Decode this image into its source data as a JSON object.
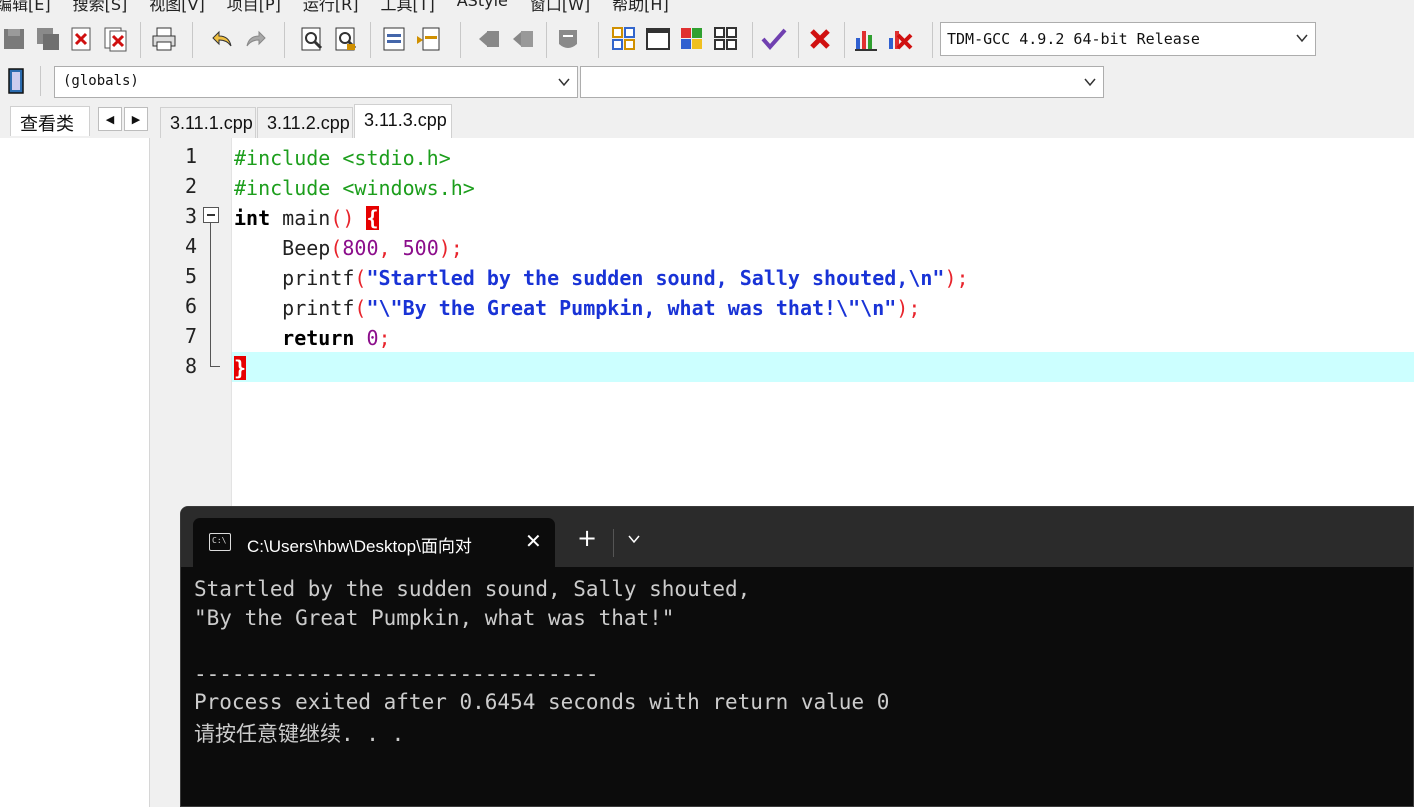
{
  "menubar": [
    "编辑[E]",
    "搜索[S]",
    "视图[V]",
    "项目[P]",
    "运行[R]",
    "工具[T]",
    "AStyle",
    "窗口[W]",
    "帮助[H]"
  ],
  "toolbar": {
    "compiler": "TDM-GCC 4.9.2 64-bit Release"
  },
  "toolbar2": {
    "scope": "(globals)",
    "member": ""
  },
  "leftpane": {
    "tab_label": "查看类"
  },
  "file_tabs": [
    "3.11.1.cpp",
    "3.11.2.cpp",
    "3.11.3.cpp"
  ],
  "active_tab": "3.11.3.cpp",
  "editor": {
    "line_numbers": [
      "1",
      "2",
      "3",
      "4",
      "5",
      "6",
      "7",
      "8"
    ],
    "line1": "#include <stdio.h>",
    "line2": "#include <windows.h>",
    "line3_kw": "int",
    "line3_fn": " main",
    "line3_sym": "() ",
    "line3_brace": "{",
    "line4_indent": "    ",
    "line4_fn": "Beep",
    "line4_open": "(",
    "line4_n1": "800",
    "line4_comma": ", ",
    "line4_n2": "500",
    "line4_close": ");",
    "line5_fn": "printf",
    "line5_open": "(",
    "line5_str": "\"Startled by the sudden sound, Sally shouted,\\n\"",
    "line5_close": ");",
    "line6_fn": "printf",
    "line6_open": "(",
    "line6_str": "\"\\\"By the Great Pumpkin, what was that!\\\"\\n\"",
    "line6_close": ");",
    "line7_kw": "return",
    "line7_space": " ",
    "line7_num": "0",
    "line7_semi": ";",
    "line8_brace": "}"
  },
  "console": {
    "tab_title": "C:\\Users\\hbw\\Desktop\\面向对",
    "close_glyph": "✕",
    "plus_glyph": "+",
    "dropdown_glyph": "∨",
    "output": [
      "Startled by the sudden sound, Sally shouted,",
      "\"By the Great Pumpkin, what was that!\"",
      "",
      "--------------------------------",
      "Process exited after 0.6454 seconds with return value 0",
      "请按任意键继续. . ."
    ]
  },
  "colors": {
    "current_line": "#ccffff",
    "brace_highlight": "#e60000",
    "string": "#1933d6",
    "preprocessor": "#1c9e1c",
    "number": "#8b0d8b",
    "console_bg": "#0c0c0c"
  }
}
